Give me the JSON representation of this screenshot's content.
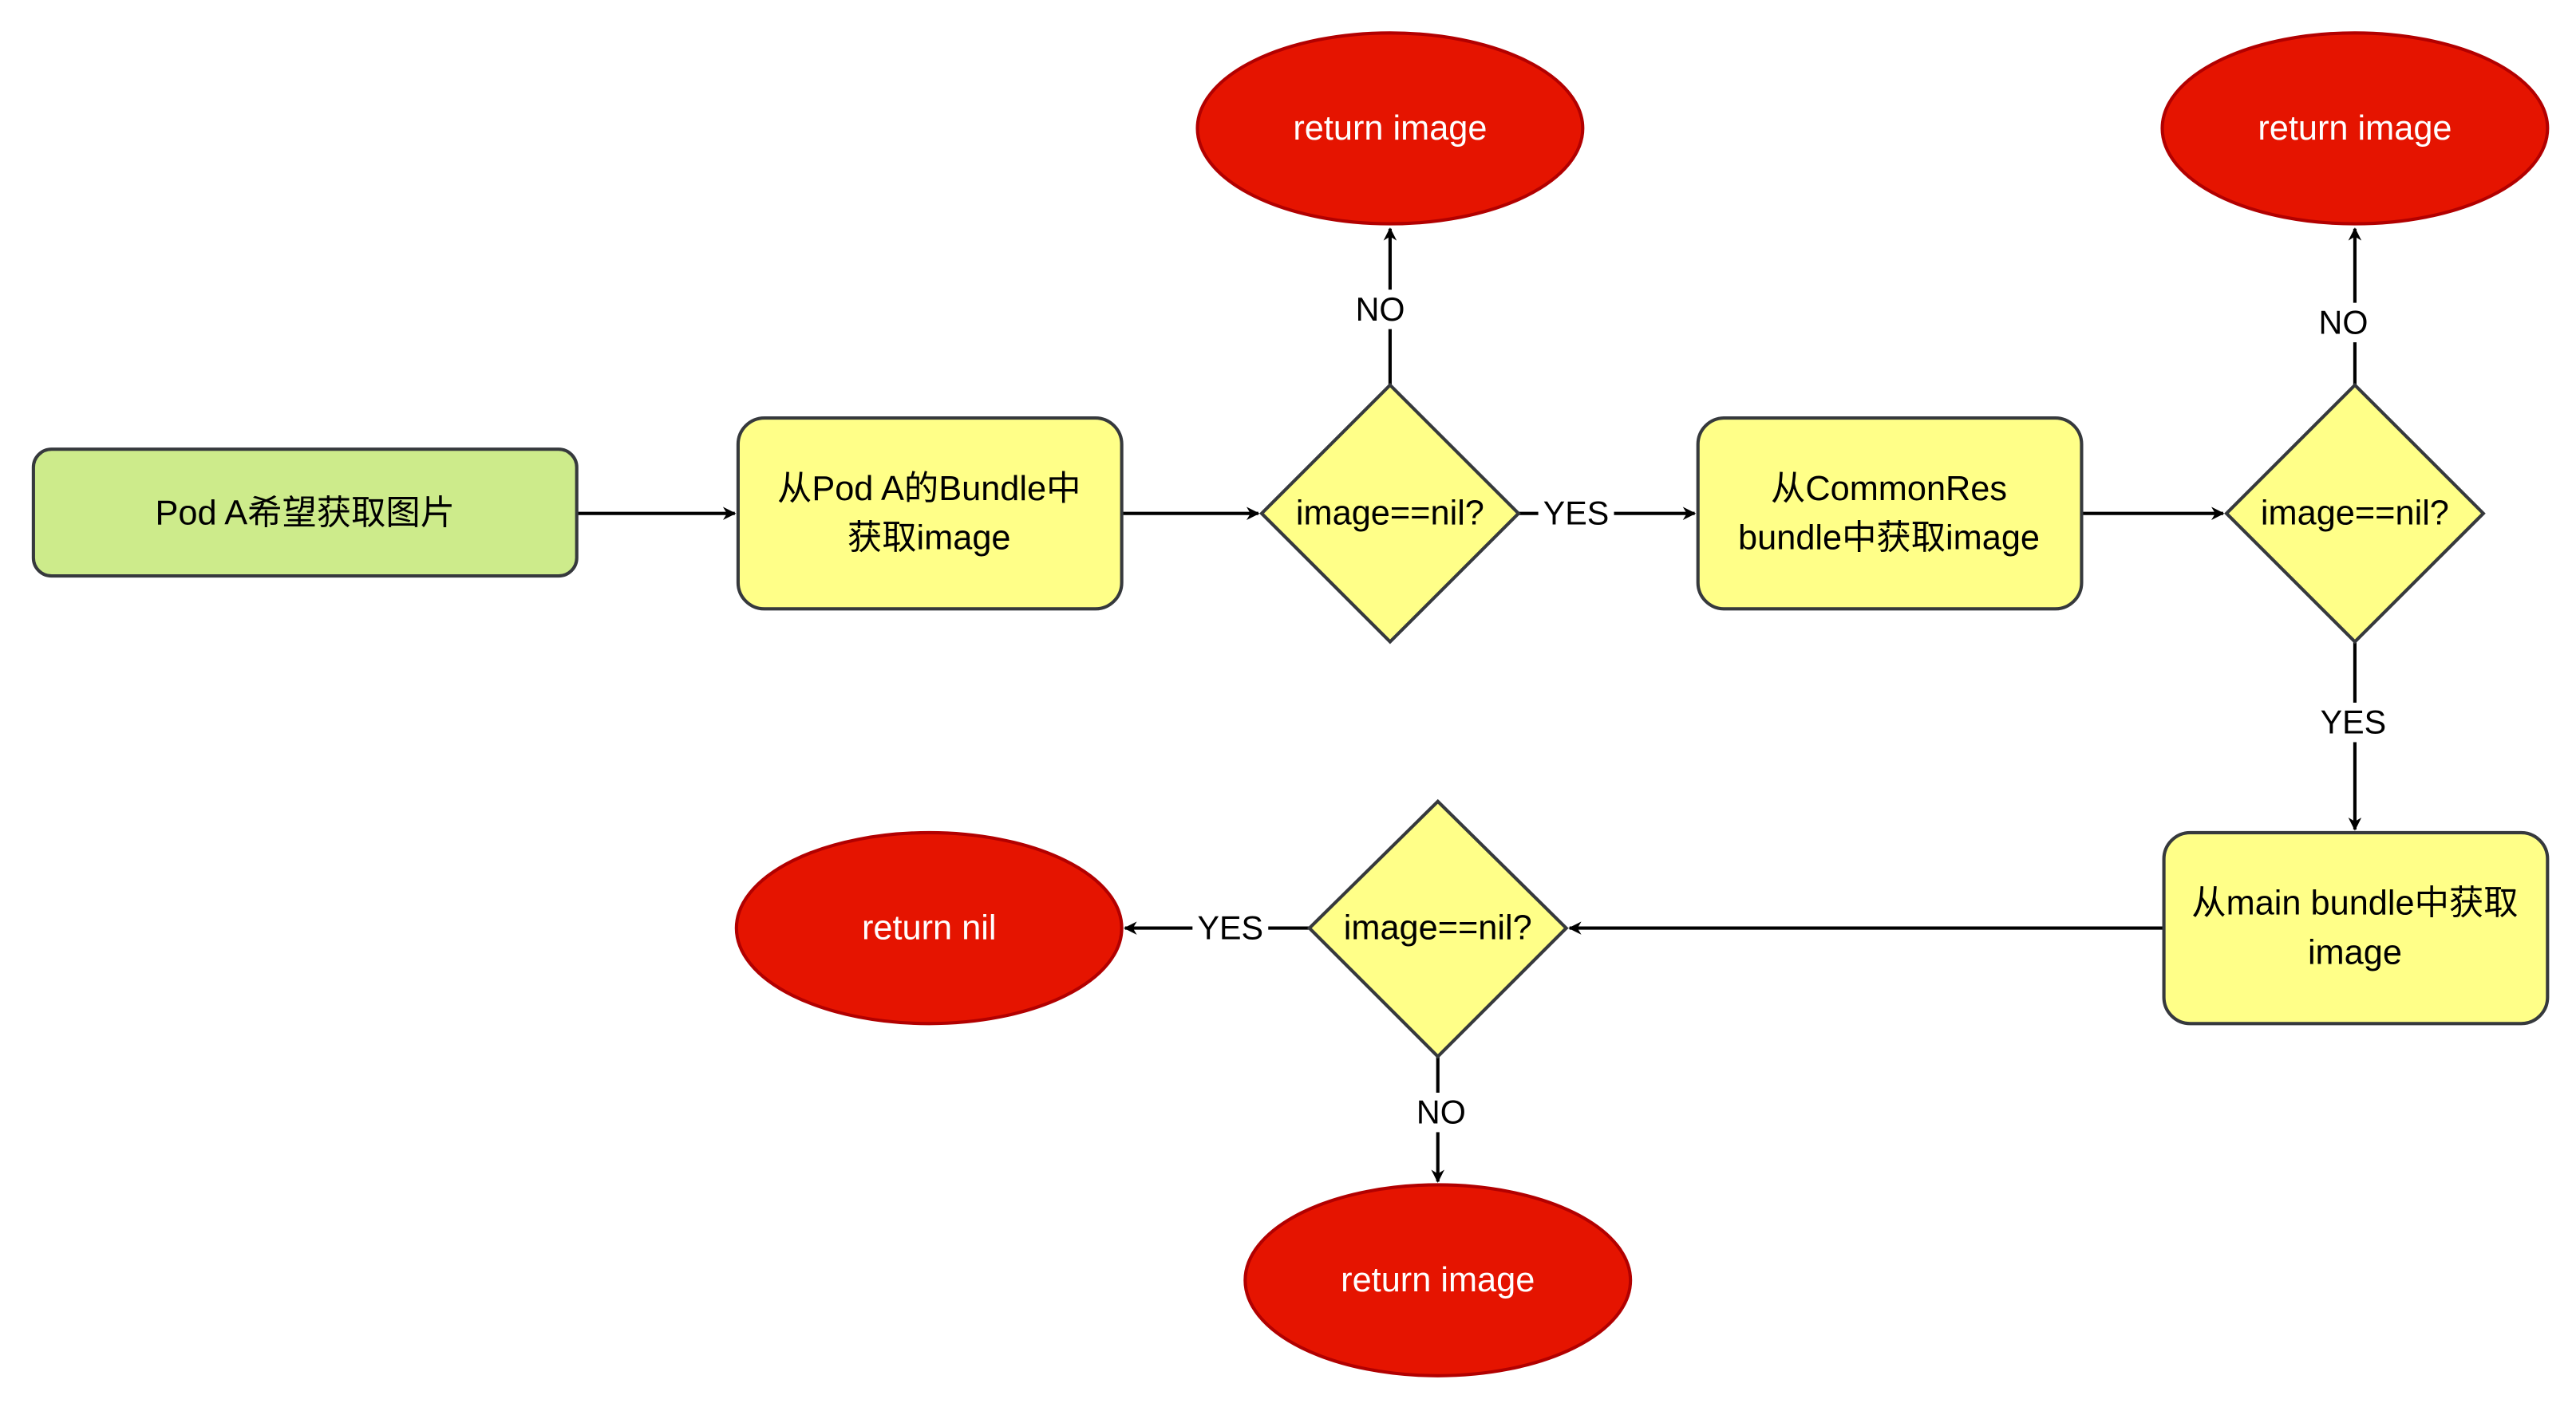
{
  "colors": {
    "start": "#cdeb8b",
    "process": "#ffff88",
    "terminal": "#e51400",
    "stroke": "#36393d"
  },
  "nodes": {
    "start": "Pod A希望获取图片",
    "podBundle": [
      "从Pod A的Bundle中",
      "获取image"
    ],
    "check1": "image==nil?",
    "return1": "return image",
    "commonRes": [
      "从CommonRes",
      "bundle中获取image"
    ],
    "check2": "image==nil?",
    "return2": "return image",
    "mainBundle": [
      "从main bundle中获取",
      "image"
    ],
    "check3": "image==nil?",
    "returnNil": "return nil",
    "return3": "return image"
  },
  "edges": {
    "check1_no": "NO",
    "check1_yes": "YES",
    "check2_no": "NO",
    "check2_yes": "YES",
    "check3_yes": "YES",
    "check3_no": "NO"
  }
}
